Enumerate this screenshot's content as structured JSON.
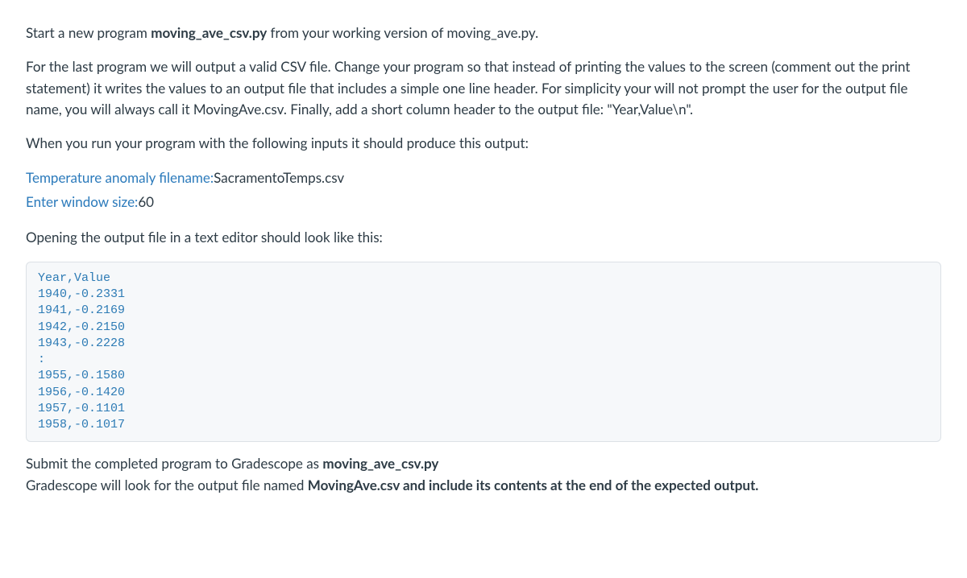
{
  "para1": {
    "pre": "Start a new program ",
    "strong1": "moving_ave_csv.py",
    "post": " from your working version of moving_ave.py."
  },
  "para2": "For the last program we will output a valid CSV file.  Change your program so that instead of printing the values to the screen (comment out the print statement) it writes the values to an output file that includes a simple one line header. For simplicity your will not prompt the user for the output file name, you will always call it MovingAve.csv. Finally, add a short column header to the output file: \"Year,Value\\n\".",
  "para3": "When you run your program with the following inputs it should produce this output:",
  "prompts": {
    "filename_label": "Temperature anomaly filename:",
    "filename_value": "SacramentoTemps.csv",
    "window_label": "Enter window size:",
    "window_value": "60"
  },
  "para4": "Opening the output  file in a text editor should look like this:",
  "code_output": "Year,Value\n1940,-0.2331\n1941,-0.2169\n1942,-0.2150\n1943,-0.2228\n:\n1955,-0.1580\n1956,-0.1420\n1957,-0.1101\n1958,-0.1017",
  "para5": {
    "line1_pre": "Submit the completed program to Gradescope as ",
    "line1_strong": "moving_ave_csv.py",
    "line2_pre": "Gradescope will look for the output file named ",
    "line2_strong": "MovingAve.csv and include its contents at the end of the expected output."
  }
}
